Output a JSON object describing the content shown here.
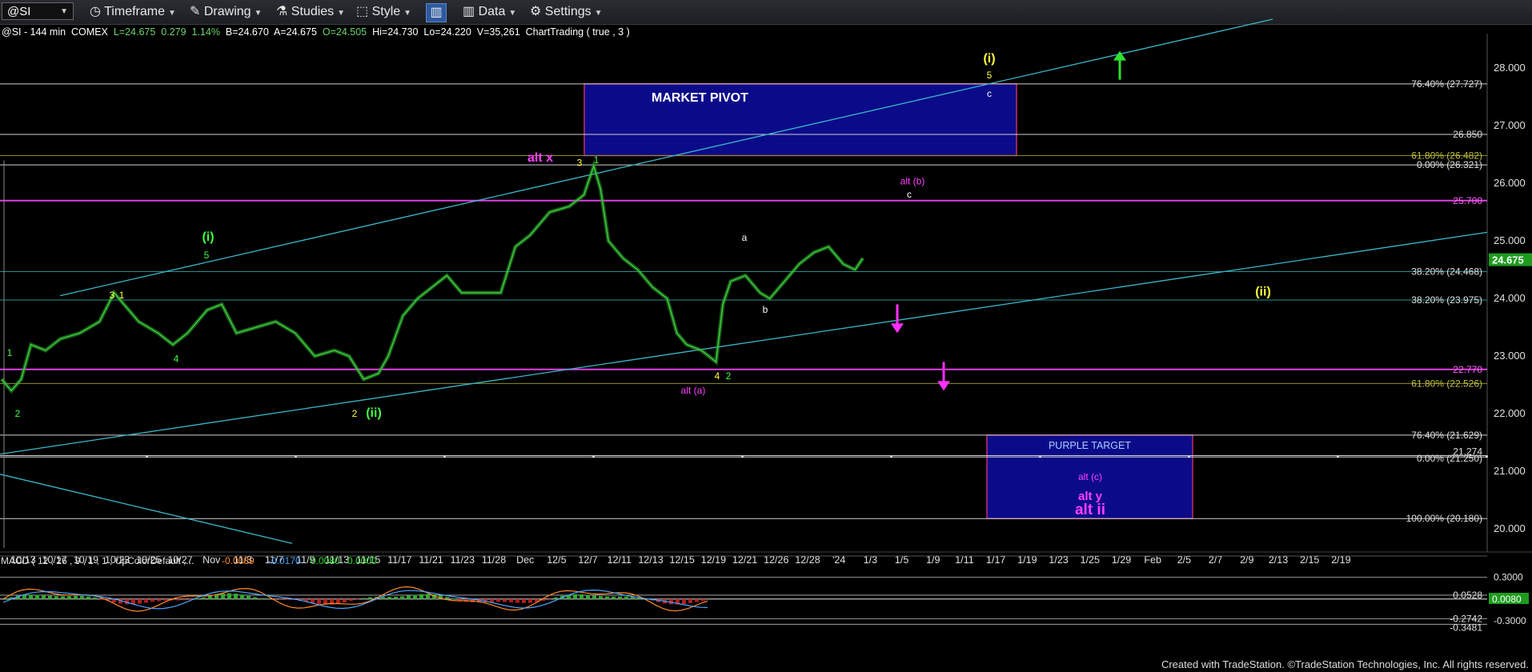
{
  "toolbar": {
    "symbol": "@SI",
    "timeframe": "Timeframe",
    "drawing": "Drawing",
    "studies": "Studies",
    "style": "Style",
    "data": "Data",
    "settings": "Settings"
  },
  "info_line": {
    "symbol": "@SI - 144 min",
    "exchange": "COMEX",
    "last": "L=24.675",
    "chg": "0.279",
    "pct": "1.14%",
    "bid": "B=24.670",
    "ask": "A=24.675",
    "open": "O=24.505",
    "hi": "Hi=24.730",
    "lo": "Lo=24.220",
    "vol": "V=35,261",
    "study": "ChartTrading ( true , 3 )"
  },
  "footer": "Created with TradeStation. ©TradeStation Technologies, Inc. All rights reserved.",
  "chart_data": {
    "type": "line",
    "title": "@SI - 144 min",
    "ylim": [
      19.6,
      28.6
    ],
    "yticks": [
      "28.000",
      "27.000",
      "26.000",
      "25.000",
      "24.000",
      "23.000",
      "22.000",
      "21.000",
      "20.000"
    ],
    "x_labels": [
      "10/13",
      "10/17",
      "10/19",
      "10/23",
      "10/25",
      "10/27",
      "Nov",
      "11/3",
      "11/7",
      "11/9",
      "11/13",
      "11/15",
      "11/17",
      "11/21",
      "11/23",
      "11/28",
      "Dec",
      "12/5",
      "12/7",
      "12/11",
      "12/13",
      "12/15",
      "12/19",
      "12/21",
      "12/26",
      "12/28",
      "'24",
      "1/3",
      "1/5",
      "1/9",
      "1/11",
      "1/17",
      "1/19",
      "1/23",
      "1/25",
      "1/29",
      "Feb",
      "2/5",
      "2/7",
      "2/9",
      "2/13",
      "2/15",
      "2/19"
    ],
    "last_price": "24.675",
    "price_path": [
      [
        0,
        22.6
      ],
      [
        10,
        22.4
      ],
      [
        20,
        22.6
      ],
      [
        30,
        23.2
      ],
      [
        45,
        23.1
      ],
      [
        60,
        23.3
      ],
      [
        80,
        23.4
      ],
      [
        100,
        23.6
      ],
      [
        115,
        24.1
      ],
      [
        125,
        23.9
      ],
      [
        140,
        23.6
      ],
      [
        160,
        23.4
      ],
      [
        175,
        23.2
      ],
      [
        190,
        23.4
      ],
      [
        210,
        23.8
      ],
      [
        225,
        23.9
      ],
      [
        240,
        23.4
      ],
      [
        260,
        23.5
      ],
      [
        280,
        23.6
      ],
      [
        300,
        23.4
      ],
      [
        320,
        23.0
      ],
      [
        340,
        23.1
      ],
      [
        355,
        23.0
      ],
      [
        370,
        22.6
      ],
      [
        385,
        22.7
      ],
      [
        395,
        23.0
      ],
      [
        410,
        23.7
      ],
      [
        425,
        24.0
      ],
      [
        440,
        24.2
      ],
      [
        455,
        24.4
      ],
      [
        470,
        24.1
      ],
      [
        490,
        24.1
      ],
      [
        510,
        24.1
      ],
      [
        525,
        24.9
      ],
      [
        540,
        25.1
      ],
      [
        560,
        25.5
      ],
      [
        580,
        25.6
      ],
      [
        595,
        25.8
      ],
      [
        605,
        26.3
      ],
      [
        612,
        25.9
      ],
      [
        620,
        25.0
      ],
      [
        635,
        24.7
      ],
      [
        650,
        24.5
      ],
      [
        665,
        24.2
      ],
      [
        680,
        24.0
      ],
      [
        690,
        23.4
      ],
      [
        700,
        23.2
      ],
      [
        715,
        23.1
      ],
      [
        730,
        22.9
      ],
      [
        737,
        23.9
      ],
      [
        745,
        24.3
      ],
      [
        760,
        24.4
      ],
      [
        775,
        24.1
      ],
      [
        785,
        24.0
      ],
      [
        800,
        24.3
      ],
      [
        815,
        24.6
      ],
      [
        830,
        24.8
      ],
      [
        845,
        24.9
      ],
      [
        860,
        24.6
      ],
      [
        872,
        24.5
      ],
      [
        880,
        24.7
      ]
    ],
    "horizontal_levels": [
      {
        "label": "76.40% (27.727)",
        "value": 27.727,
        "color": "#cfcfcf"
      },
      {
        "label": "26.850",
        "value": 26.85,
        "color": "#cfcfcf"
      },
      {
        "label": "61.80% (26.482)",
        "value": 26.482,
        "color": "#8d8d2a"
      },
      {
        "label": "0.00% (26.321)",
        "value": 26.321,
        "color": "#cfcfcf"
      },
      {
        "label": "25.700",
        "value": 25.7,
        "color": "#e040e0"
      },
      {
        "label": "38.20% (24.468)",
        "value": 24.468,
        "color": "#2a8f8f"
      },
      {
        "label": "38.20% (23.975)",
        "value": 23.975,
        "color": "#2a8f8f"
      },
      {
        "label": "22.770",
        "value": 22.77,
        "color": "#e040e0"
      },
      {
        "label": "61.80% (22.526)",
        "value": 22.526,
        "color": "#8d8d2a"
      },
      {
        "label": "76.40% (21.629)",
        "value": 21.629,
        "color": "#cfcfcf"
      },
      {
        "label": "0.00% (21.250)",
        "value": 21.25,
        "color": "#cfcfcf"
      },
      {
        "label": "21.274",
        "value": 21.274,
        "color": "#cfcfcf"
      },
      {
        "label": "100.00% (20.180)",
        "value": 20.18,
        "color": "#cfcfcf"
      }
    ],
    "boxes": [
      {
        "label": "MARKET PIVOT",
        "y_top": 27.727,
        "y_bottom": 26.482
      },
      {
        "label": "PURPLE TARGET",
        "y_top": 21.629,
        "y_bottom": 20.18
      }
    ],
    "annotations": [
      {
        "text": "(i)",
        "color": "#ffff40"
      },
      {
        "text": "5",
        "color": "#ffff40"
      },
      {
        "text": "c",
        "color": "#ffffff"
      },
      {
        "text": "alt x",
        "color": "#ff40ff"
      },
      {
        "text": "3",
        "color": "#ffff40"
      },
      {
        "text": "1",
        "color": "#40ff40"
      },
      {
        "text": "alt (b)",
        "color": "#ff40ff"
      },
      {
        "text": "c",
        "color": "#ffffff"
      },
      {
        "text": "(i)",
        "color": "#40ff40"
      },
      {
        "text": "3",
        "color": "#ffff40"
      },
      {
        "text": "1",
        "color": "#ffff40"
      },
      {
        "text": "5",
        "color": "#40ff40"
      },
      {
        "text": "1",
        "color": "#40ff40"
      },
      {
        "text": "2",
        "color": "#40ff40"
      },
      {
        "text": "4",
        "color": "#40ff40"
      },
      {
        "text": "2",
        "color": "#ffff40"
      },
      {
        "text": "(ii)",
        "color": "#40ff40"
      },
      {
        "text": "a",
        "color": "#ffffff"
      },
      {
        "text": "b",
        "color": "#ffffff"
      },
      {
        "text": "4",
        "color": "#ffff40"
      },
      {
        "text": "2",
        "color": "#40ff40"
      },
      {
        "text": "alt (a)",
        "color": "#ff40ff"
      },
      {
        "text": "(ii)",
        "color": "#ffff40"
      },
      {
        "text": "alt (c)",
        "color": "#ff40ff"
      },
      {
        "text": "alt y",
        "color": "#ff40ff"
      },
      {
        "text": "alt ii",
        "color": "#ff40ff"
      }
    ],
    "macd": {
      "label": "MACD ( 12 , 26 , 9 , 1 , 1 , UpColorDefault ,...",
      "values": [
        "-0.0089",
        "-0.0170",
        "0.0080",
        "0.0000"
      ],
      "yticks": [
        "0.3000",
        "0.0528",
        "0.0080",
        "-0.2742",
        "-0.3481",
        "-0.3000"
      ]
    }
  }
}
